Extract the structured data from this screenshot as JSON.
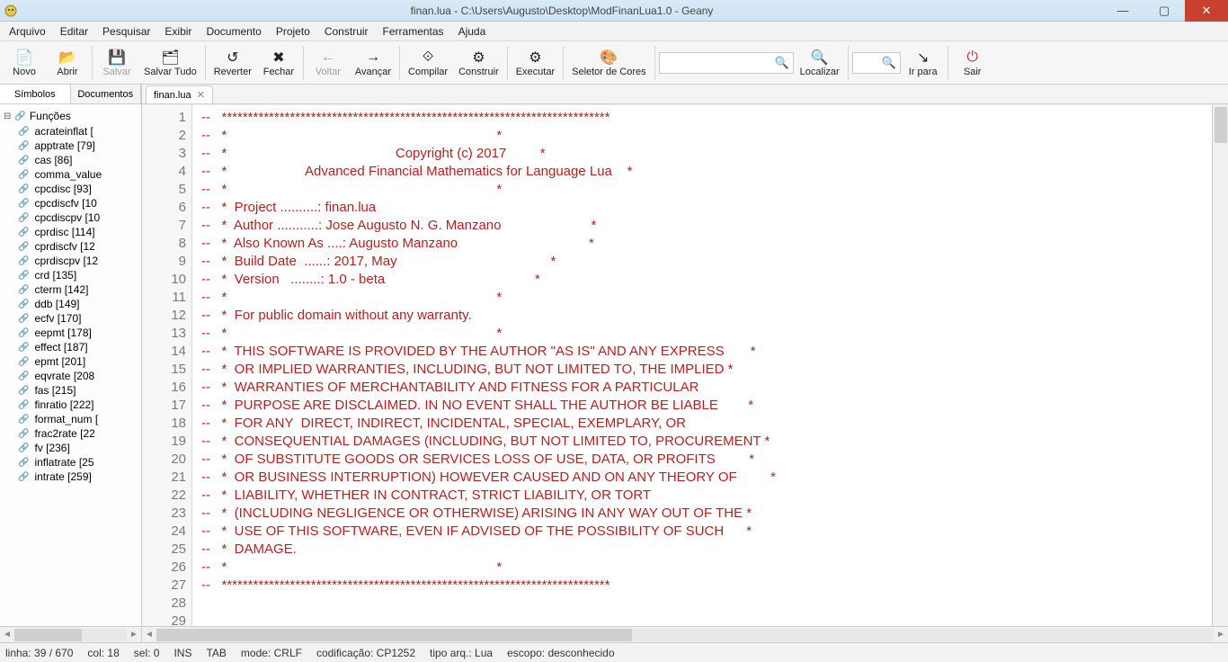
{
  "window": {
    "title": "finan.lua - C:\\Users\\Augusto\\Desktop\\ModFinanLua1.0 - Geany"
  },
  "menus": [
    "Arquivo",
    "Editar",
    "Pesquisar",
    "Exibir",
    "Documento",
    "Projeto",
    "Construir",
    "Ferramentas",
    "Ajuda"
  ],
  "toolbar": {
    "novo": "Novo",
    "abrir": "Abrir",
    "salvar": "Salvar",
    "salvartudo": "Salvar Tudo",
    "reverter": "Reverter",
    "fechar": "Fechar",
    "voltar": "Voltar",
    "avancar": "Avançar",
    "compilar": "Compilar",
    "construir": "Construir",
    "executar": "Executar",
    "seletor": "Seletor de Cores",
    "localizar": "Localizar",
    "irpara": "Ir para",
    "sair": "Sair"
  },
  "sidebar": {
    "tabs": [
      "Símbolos",
      "Documentos"
    ],
    "root": "Funções",
    "items": [
      "acrateinflat [",
      "apptrate [79]",
      "cas [86]",
      "comma_value",
      "cpcdisc [93]",
      "cpcdiscfv [10",
      "cpcdiscpv [10",
      "cprdisc [114]",
      "cprdiscfv [12",
      "cprdiscpv [12",
      "crd [135]",
      "cterm [142]",
      "ddb [149]",
      "ecfv [170]",
      "eepmt [178]",
      "effect [187]",
      "epmt [201]",
      "eqvrate [208",
      "fas [215]",
      "finratio [222]",
      "format_num [",
      "frac2rate [22",
      "fv [236]",
      "inflatrate [25",
      "intrate [259]"
    ]
  },
  "editor": {
    "tab": "finan.lua",
    "lines": [
      "--   **************************************************************************",
      "--   *                                                                        *",
      "--   *                                             Copyright (c) 2017         *",
      "--   *                     Advanced Financial Mathematics for Language Lua    *",
      "--   *                                                                        *",
      "--   *  Project ..........: finan.lua                                         ",
      "--   *  Author ...........: Jose Augusto N. G. Manzano                        *",
      "--   *  Also Known As ....: Augusto Manzano                                   *",
      "--   *  Build Date  ......: 2017, May                                         *",
      "--   *  Version   ........: 1.0 - beta                                        *",
      "--   *                                                                        *",
      "--   *  For public domain without any warranty.                               ",
      "--   *                                                                        *",
      "--   *  THIS SOFTWARE IS PROVIDED BY THE AUTHOR \"AS IS\" AND ANY EXPRESS       *",
      "--   *  OR IMPLIED WARRANTIES, INCLUDING, BUT NOT LIMITED TO, THE IMPLIED *",
      "--   *  WARRANTIES OF MERCHANTABILITY AND FITNESS FOR A PARTICULAR            ",
      "--   *  PURPOSE ARE DISCLAIMED. IN NO EVENT SHALL THE AUTHOR BE LIABLE        *",
      "--   *  FOR ANY  DIRECT, INDIRECT, INCIDENTAL, SPECIAL, EXEMPLARY, OR          ",
      "--   *  CONSEQUENTIAL DAMAGES (INCLUDING, BUT NOT LIMITED TO, PROCUREMENT *",
      "--   *  OF SUBSTITUTE GOODS OR SERVICES LOSS OF USE, DATA, OR PROFITS         *",
      "--   *  OR BUSINESS INTERRUPTION) HOWEVER CAUSED AND ON ANY THEORY OF         *",
      "--   *  LIABILITY, WHETHER IN CONTRACT, STRICT LIABILITY, OR TORT             ",
      "--   *  (INCLUDING NEGLIGENCE OR OTHERWISE) ARISING IN ANY WAY OUT OF THE *",
      "--   *  USE OF THIS SOFTWARE, EVEN IF ADVISED OF THE POSSIBILITY OF SUCH      *",
      "--   *  DAMAGE.                                                               ",
      "--   *                                                                        *",
      "--   **************************************************************************",
      "",
      ""
    ]
  },
  "status": {
    "linha": "linha: 39 / 670",
    "col": "col: 18",
    "sel": "sel: 0",
    "ins": "INS",
    "tab": "TAB",
    "mode": "mode: CRLF",
    "cod": "codificação: CP1252",
    "tipo": "tipo arq.: Lua",
    "escopo": "escopo: desconhecido"
  }
}
